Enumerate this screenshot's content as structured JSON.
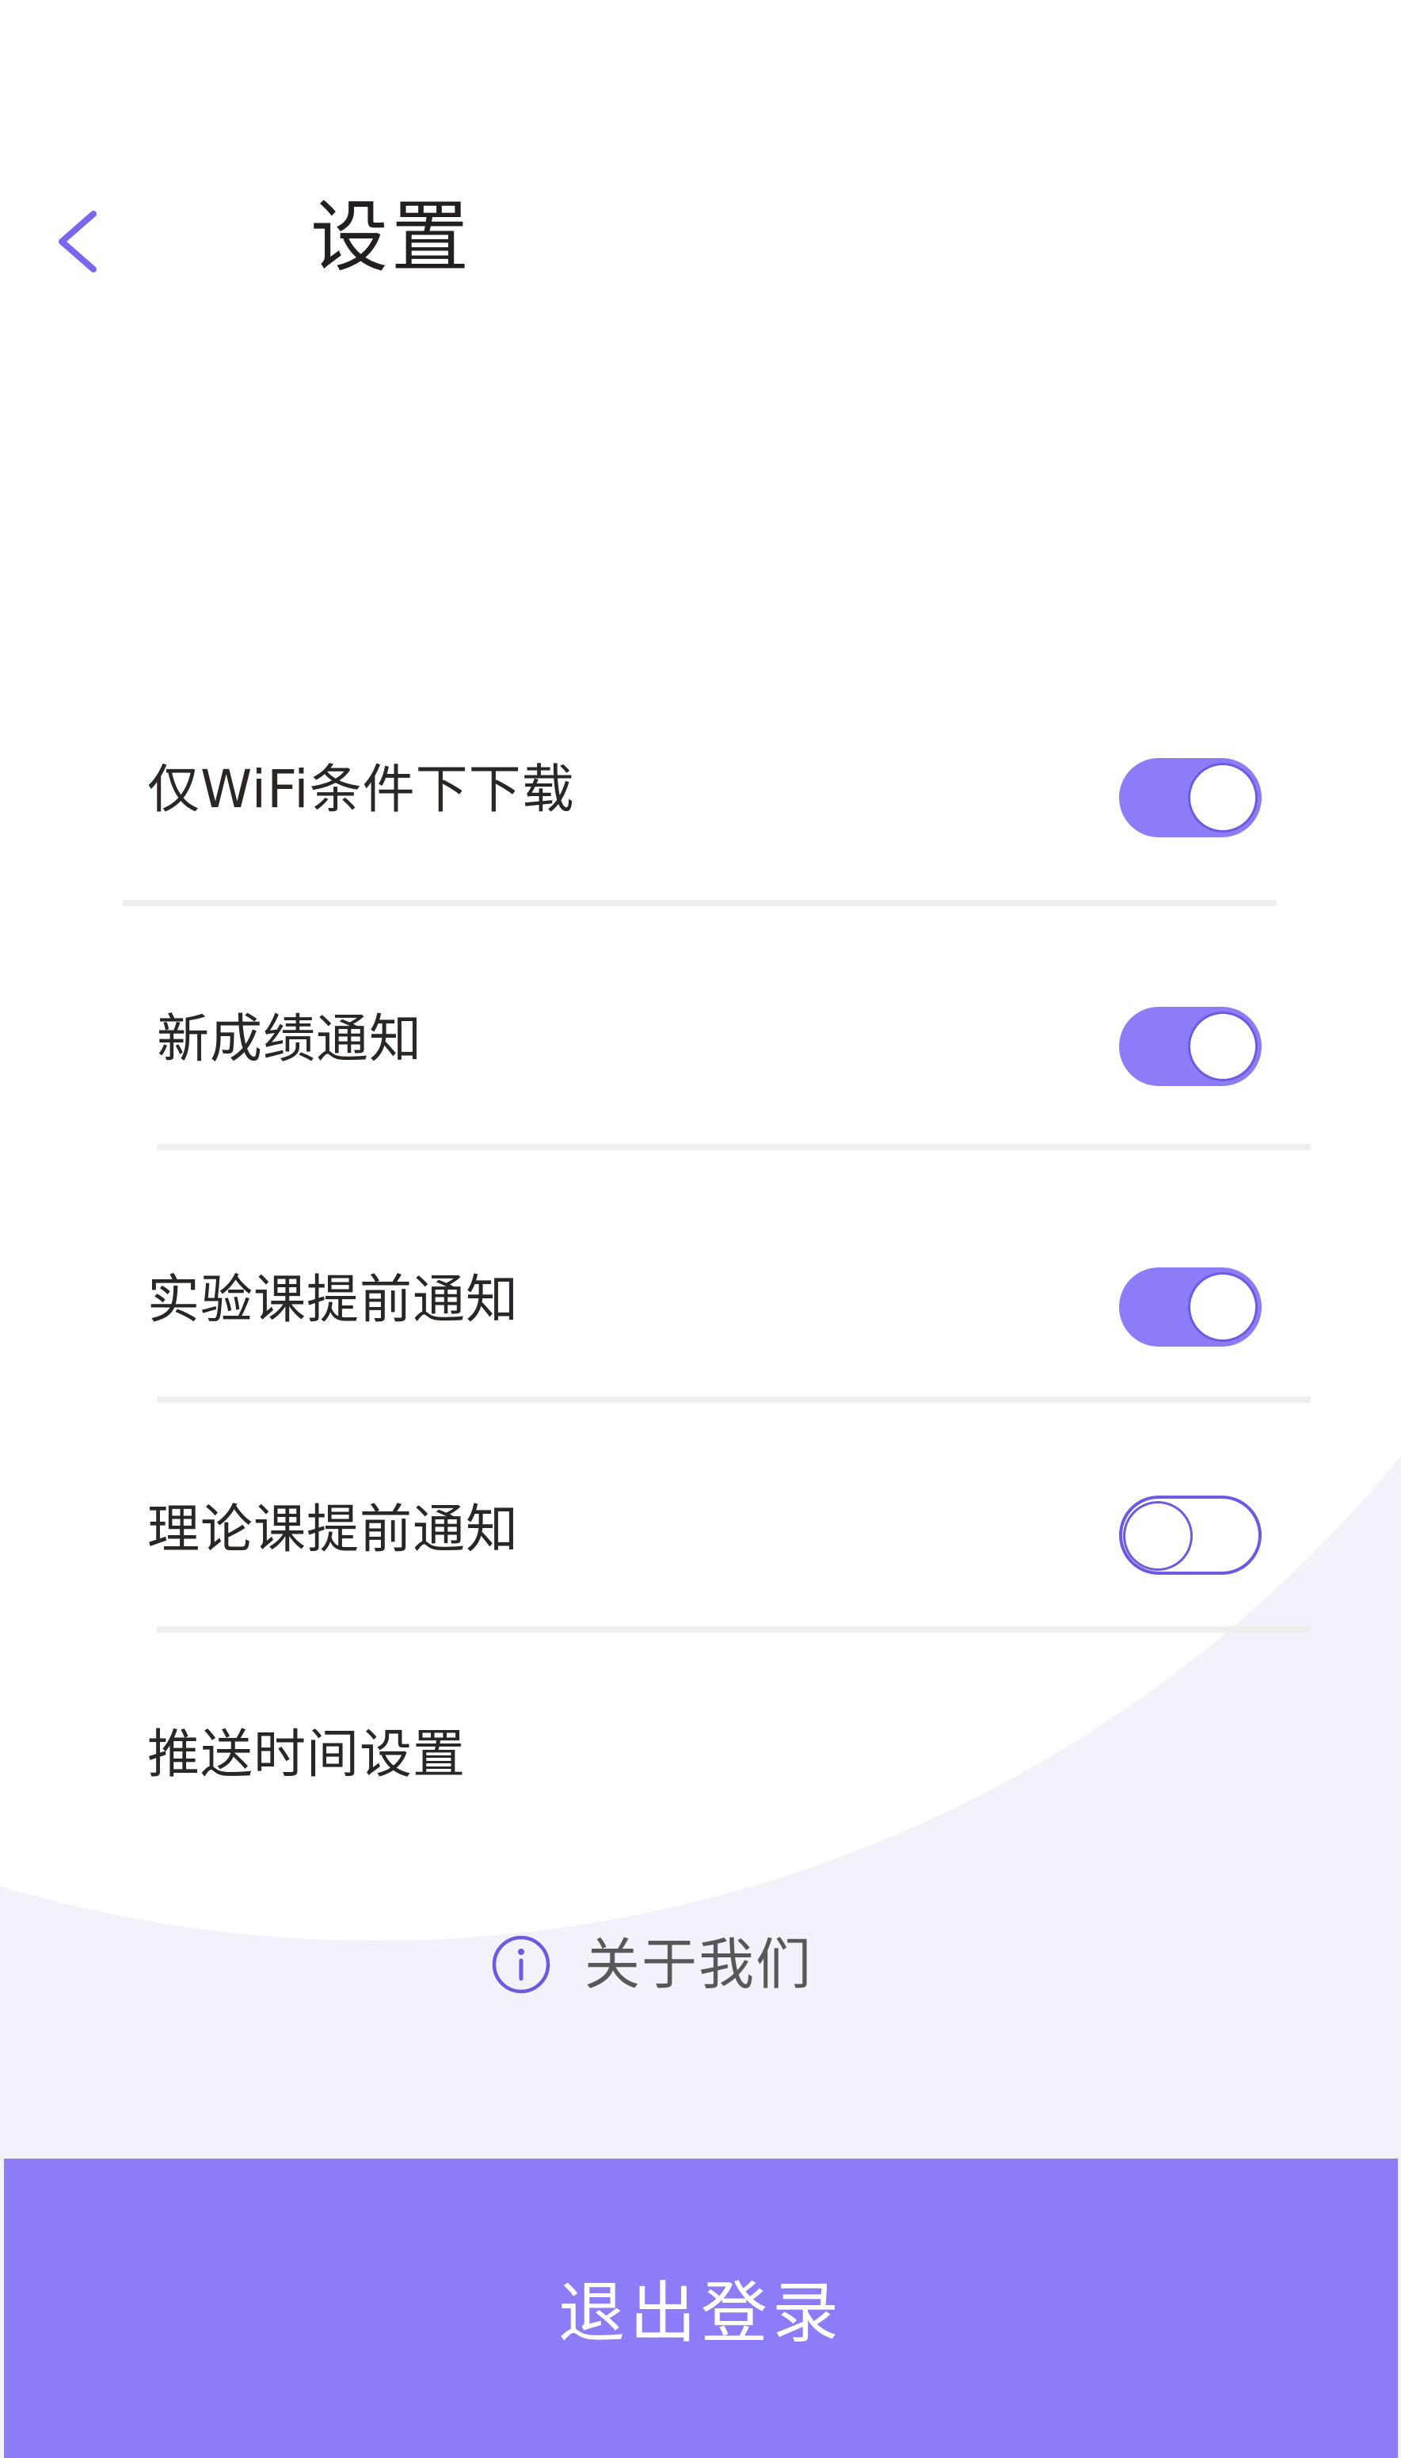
{
  "header": {
    "back_icon": "chevron-left-icon",
    "title": "设置"
  },
  "settings": {
    "wifi_only_download": {
      "label": "仅WiFi条件下下载",
      "enabled": true
    },
    "new_grade_notification": {
      "label": "新成绩通知",
      "enabled": true
    },
    "lab_class_reminder": {
      "label": "实验课提前通知",
      "enabled": true
    },
    "theory_class_reminder": {
      "label": "理论课提前通知",
      "enabled": false
    },
    "push_time_settings": {
      "label": "推送时间设置"
    }
  },
  "about": {
    "icon": "info-icon",
    "label": "关于我们"
  },
  "logout": {
    "label": "退出登录"
  },
  "colors": {
    "accent": "#8d7cf8",
    "accent_dark": "#6d5ae0",
    "background_curve": "#f3f1f9",
    "text_primary": "#2a2624",
    "divider": "#eeeeee"
  }
}
